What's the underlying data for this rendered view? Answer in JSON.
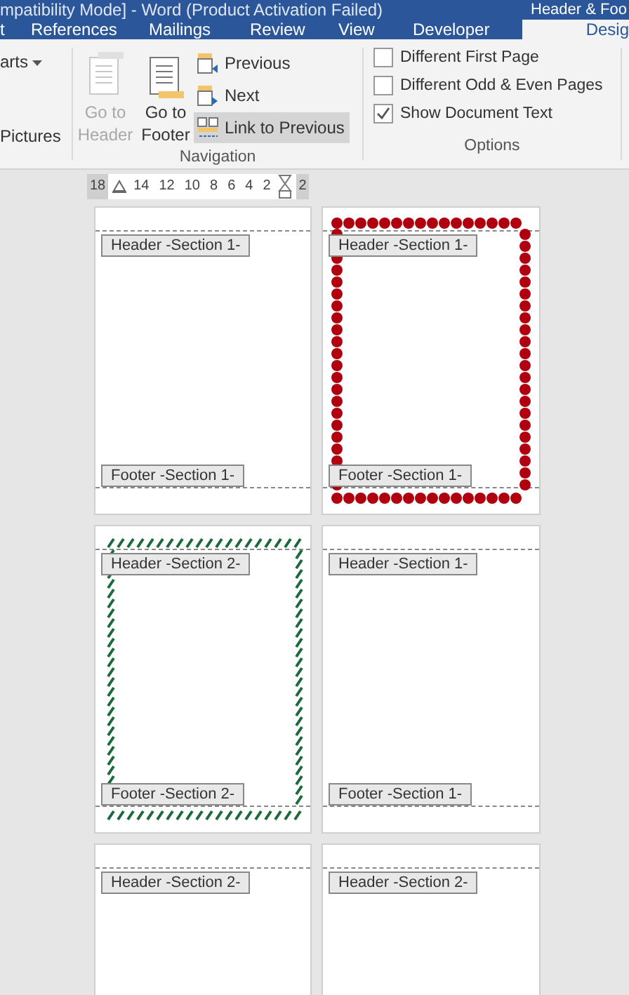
{
  "window": {
    "title": "mpatibility Mode] - Word (Product Activation Failed)",
    "context_title": "Header & Foo"
  },
  "tabs": [
    {
      "label": "t",
      "selected": false
    },
    {
      "label": "References",
      "selected": false
    },
    {
      "label": "Mailings",
      "selected": false
    },
    {
      "label": "Review",
      "selected": false
    },
    {
      "label": "View",
      "selected": false
    },
    {
      "label": "Developer",
      "selected": false
    },
    {
      "label": "Desig",
      "selected": true
    }
  ],
  "ribbon": {
    "partial_group": {
      "items": [
        {
          "label": "arts",
          "dropdown": true
        },
        {
          "label": "Pictures",
          "dropdown": false
        }
      ]
    },
    "navigation": {
      "label": "Navigation",
      "large_buttons": [
        {
          "label": "Go to Header",
          "kind": "header",
          "disabled": true
        },
        {
          "label": "Go to Footer",
          "kind": "footer",
          "disabled": false
        }
      ],
      "small_buttons": [
        {
          "label": "Previous",
          "kind": "previous",
          "selected": false
        },
        {
          "label": "Next",
          "kind": "next",
          "selected": false
        },
        {
          "label": "Link to Previous",
          "kind": "link",
          "selected": true
        }
      ]
    },
    "options": {
      "label": "Options",
      "checkboxes": [
        {
          "label": "Different First Page",
          "checked": false
        },
        {
          "label": "Different Odd & Even Pages",
          "checked": false
        },
        {
          "label": "Show Document Text",
          "checked": true
        }
      ]
    }
  },
  "ruler": {
    "numbers": [
      "18",
      "14",
      "12",
      "10",
      "8",
      "6",
      "4",
      "2",
      "2"
    ]
  },
  "pages": [
    {
      "header": "Header -Section 1-",
      "footer": "Footer -Section 1-",
      "kind": "plain"
    },
    {
      "header": "Header -Section 1-",
      "footer": "Footer -Section 1-",
      "kind": "dots"
    },
    {
      "header": "Header -Section 2-",
      "footer": "Footer -Section 2-",
      "kind": "hatch"
    },
    {
      "header": "Header -Section 1-",
      "footer": "Footer -Section 1-",
      "kind": "plain"
    },
    {
      "header": "Header -Section 2-",
      "kind": "plain"
    },
    {
      "header": "Header -Section 2-",
      "kind": "plain"
    }
  ]
}
